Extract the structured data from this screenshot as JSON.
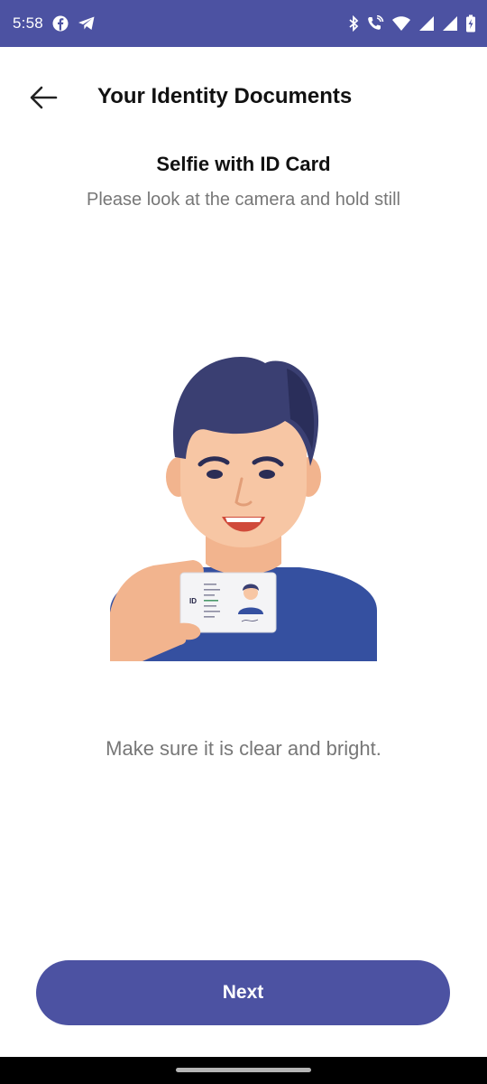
{
  "status_bar": {
    "time": "5:58",
    "left_icons": [
      "facebook-icon",
      "telegram-icon"
    ],
    "right_icons": [
      "bluetooth-icon",
      "wifi-calling-icon",
      "wifi-icon",
      "signal-icon",
      "signal-icon",
      "battery-charging-icon"
    ]
  },
  "header": {
    "back_icon": "arrow-left-icon",
    "title": "Your Identity Documents"
  },
  "section": {
    "title": "Selfie with ID Card",
    "subtitle": "Please look at the camera and hold still"
  },
  "illustration": {
    "description_icon": "selfie-with-id-card-illustration",
    "id_card_badge": "ID"
  },
  "hint": "Make sure it is clear and bright.",
  "actions": {
    "next_label": "Next"
  },
  "colors": {
    "brand": "#4c52a2",
    "title_text": "#111111",
    "muted_text": "#777777",
    "background": "#ffffff"
  }
}
